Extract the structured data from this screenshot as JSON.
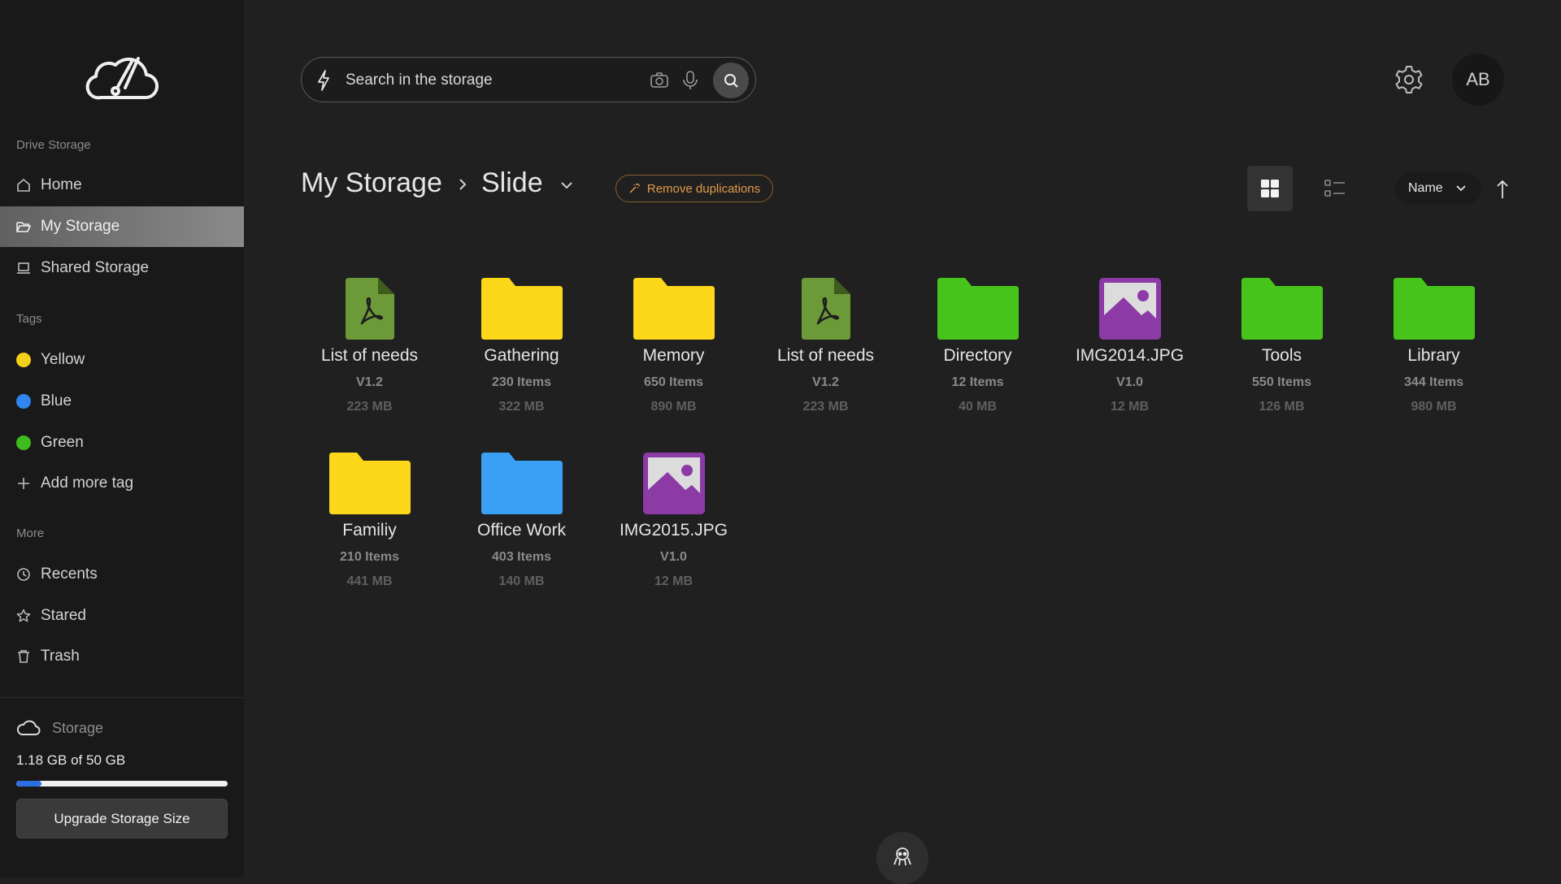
{
  "sidebar": {
    "logo_icon": "cloud-speedometer-logo",
    "section_drive": "Drive Storage",
    "nav": [
      {
        "label": "Home",
        "icon": "home-icon"
      },
      {
        "label": "My Storage",
        "icon": "folder-open-icon",
        "active": true
      },
      {
        "label": "Shared Storage",
        "icon": "laptop-icon"
      }
    ],
    "section_tags": "Tags",
    "tags": [
      {
        "label": "Yellow",
        "color": "#f5d01a"
      },
      {
        "label": "Blue",
        "color": "#2f86f0"
      },
      {
        "label": "Green",
        "color": "#3dbb1f"
      }
    ],
    "add_tag": "Add more tag",
    "section_more": "More",
    "more": [
      {
        "label": "Recents",
        "icon": "clock-icon"
      },
      {
        "label": "Stared",
        "icon": "star-icon"
      },
      {
        "label": "Trash",
        "icon": "trash-icon"
      }
    ],
    "storage": {
      "label": "Storage",
      "usage": "1.18 GB of 50 GB",
      "used_fraction": 0.0236,
      "upgrade_label": "Upgrade Storage Size"
    }
  },
  "header": {
    "search_placeholder": "Search in the storage",
    "avatar_initials": "AB"
  },
  "breadcrumb": {
    "root": "My Storage",
    "current": "Slide"
  },
  "actions": {
    "remove_duplications": "Remove duplications",
    "sort_label": "Name"
  },
  "colors": {
    "folder_yellow": "#fcd71a",
    "folder_green": "#47c41c",
    "folder_blue": "#3aa0f6",
    "pdf_green": "#6d9a38",
    "image_purple": "#8c3aa6",
    "accent_orange": "#e09a4c",
    "progress_blue": "#2c6fe0"
  },
  "files": [
    {
      "name": "List of needs",
      "type": "pdf",
      "meta1": "V1.2",
      "meta2": "223 MB"
    },
    {
      "name": "Gathering",
      "type": "folder",
      "color": "yellow",
      "meta1": "230 Items",
      "meta2": "322 MB"
    },
    {
      "name": "Memory",
      "type": "folder",
      "color": "yellow",
      "meta1": "650 Items",
      "meta2": "890 MB"
    },
    {
      "name": "List of needs",
      "type": "pdf",
      "meta1": "V1.2",
      "meta2": "223 MB"
    },
    {
      "name": "Directory",
      "type": "folder",
      "color": "green",
      "meta1": "12 Items",
      "meta2": "40 MB"
    },
    {
      "name": "IMG2014.JPG",
      "type": "image",
      "meta1": "V1.0",
      "meta2": "12 MB"
    },
    {
      "name": "Tools",
      "type": "folder",
      "color": "green",
      "meta1": "550 Items",
      "meta2": "126 MB"
    },
    {
      "name": "Library",
      "type": "folder",
      "color": "green",
      "meta1": "344 Items",
      "meta2": "980 MB"
    },
    {
      "name": "Familiy",
      "type": "folder",
      "color": "yellow",
      "meta1": "210 Items",
      "meta2": "441 MB"
    },
    {
      "name": "Office Work",
      "type": "folder",
      "color": "blue",
      "meta1": "403 Items",
      "meta2": "140 MB"
    },
    {
      "name": "IMG2015.JPG",
      "type": "image",
      "meta1": "V1.0",
      "meta2": "12 MB"
    }
  ]
}
